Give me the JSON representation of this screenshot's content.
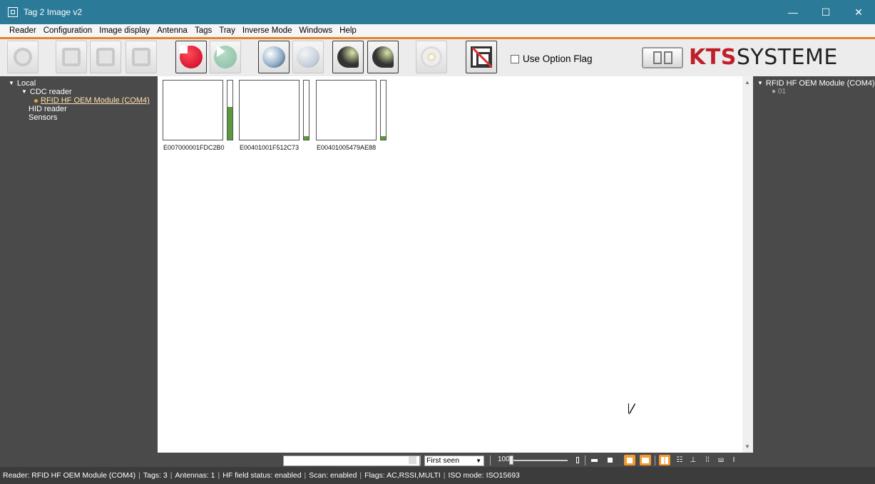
{
  "window": {
    "title": "Tag 2 Image v2",
    "controls": [
      "—",
      "☐",
      "✕"
    ]
  },
  "menu": [
    "Reader",
    "Configuration",
    "Image display",
    "Antenna",
    "Tags",
    "Tray",
    "Inverse Mode",
    "Windows",
    "Help"
  ],
  "toolbar": {
    "buttons": [
      {
        "name": "reader-scan-button",
        "icon": "reader-icon",
        "enabled": false
      },
      {
        "name": "tag-write-button",
        "icon": "tag-edit-icon",
        "enabled": false
      },
      {
        "name": "tag-export-button",
        "icon": "tag-export-icon",
        "enabled": false
      },
      {
        "name": "tag-delete-button",
        "icon": "tag-delete-icon",
        "enabled": false
      },
      {
        "name": "stop-button",
        "icon": "stop-icon",
        "enabled": true
      },
      {
        "name": "play-button",
        "icon": "play-icon",
        "enabled": false
      },
      {
        "name": "antenna-dish-button",
        "icon": "satellite-dish-icon",
        "enabled": true
      },
      {
        "name": "antenna-dish-off-button",
        "icon": "satellite-dish-icon",
        "enabled": false
      },
      {
        "name": "antenna-signal-button",
        "icon": "antenna-signal-icon",
        "enabled": true
      },
      {
        "name": "antenna-level-button",
        "icon": "antenna-level-icon",
        "enabled": true
      },
      {
        "name": "disc-button",
        "icon": "disc-icon",
        "enabled": false
      },
      {
        "name": "inverse-mode-button",
        "icon": "no-tag-icon",
        "enabled": true
      }
    ],
    "option_flag_label": "Use Option Flag",
    "option_flag_checked": false
  },
  "logo": {
    "kts": "KTS",
    "systeme": "SYSTEME",
    "kts_color": "#c01f2a"
  },
  "left_tree": {
    "root": "Local",
    "group": "CDC reader",
    "selected_device": "RFID HF OEM Module (COM4)",
    "items": [
      "HID reader",
      "Sensors"
    ]
  },
  "tags": [
    {
      "id": "E007000001FDC2B0",
      "signal": 0.55
    },
    {
      "id": "E00401001F512C73",
      "signal": 0.06
    },
    {
      "id": "E00401005479AE88",
      "signal": 0.06
    }
  ],
  "right_tree": {
    "device": "RFID HF OEM Module (COM4)",
    "antenna": "01"
  },
  "controls": {
    "search_value": "",
    "sort_selected": "First seen",
    "zoom_value": "100",
    "zoom_fraction": 0.0
  },
  "statusbar": {
    "reader": "Reader: RFID HF OEM Module (COM4)",
    "tags": "Tags: 3",
    "antennas": "Antennas: 1",
    "hf_field": "HF field status: enabled",
    "scan": "Scan: enabled",
    "flags": "Flags: AC,RSSI,MULTI",
    "iso": "ISO mode: ISO15693"
  },
  "colors": {
    "titlebar": "#2b7a98",
    "accent": "#e8822a",
    "panel": "#4a4a4a",
    "signal": "#5a9a3c",
    "active_view": "#f29a32"
  }
}
